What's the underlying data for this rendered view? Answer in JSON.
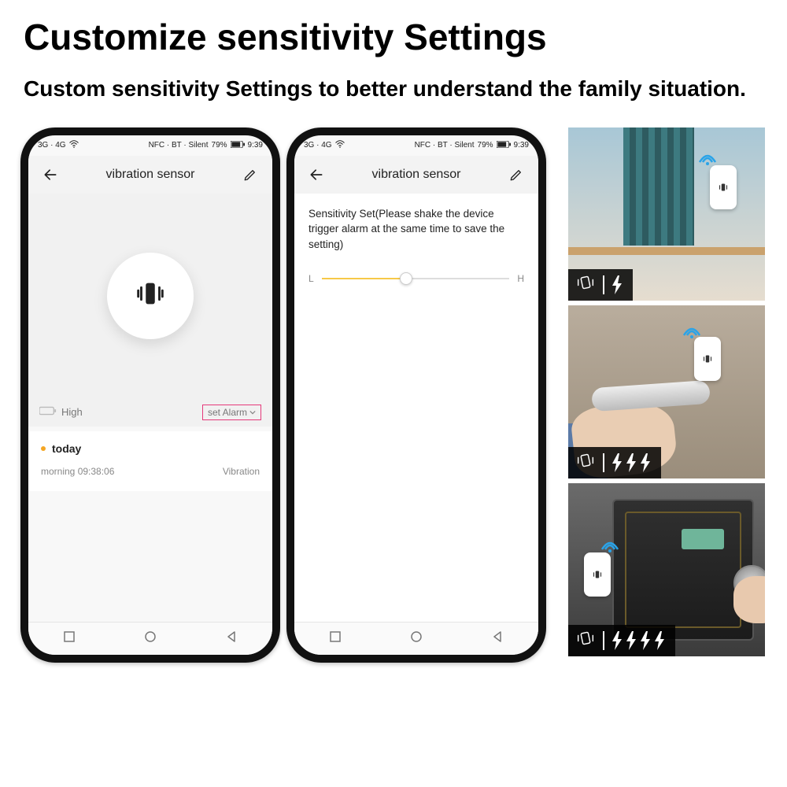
{
  "headline": "Customize sensitivity Settings",
  "subhead": "Custom sensitivity Settings to better understand the family situation.",
  "status": {
    "signal": "3G · 4G",
    "icons": "NFC · BT · Silent",
    "battery": "79%",
    "time": "9:39"
  },
  "phone1": {
    "title": "vibration sensor",
    "battery_label": "High",
    "set_alarm_label": "set Alarm",
    "today_label": "today",
    "event_time_label": "morning  09:38:06",
    "event_type": "Vibration"
  },
  "phone2": {
    "title": "vibration sensor",
    "sensitivity_text": "Sensitivity Set(Please shake the device trigger alarm at the same time to save the setting)",
    "low_label": "L",
    "high_label": "H",
    "slider_percent": 45
  },
  "tiles": {
    "room_bolts": 1,
    "door_bolts": 3,
    "safe_bolts": 4
  }
}
